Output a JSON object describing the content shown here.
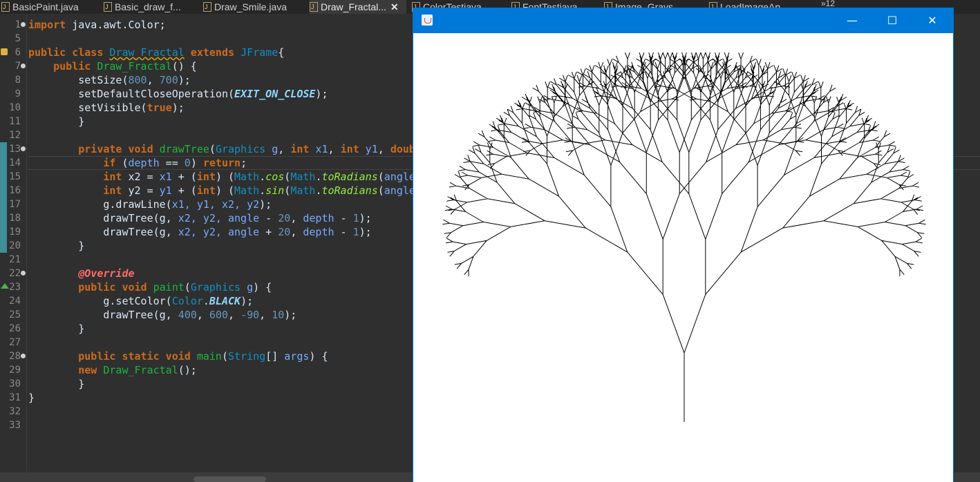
{
  "tabs": [
    {
      "label": "BasicPaint.java",
      "active": false
    },
    {
      "label": "Basic_draw_f...",
      "active": false
    },
    {
      "label": "Draw_Smile.java",
      "active": false
    },
    {
      "label": "Draw_Fractal...",
      "active": true,
      "close": "✕"
    },
    {
      "label": "ColorTestjava",
      "active": false
    },
    {
      "label": "FontTestjava",
      "active": false
    },
    {
      "label": "Image_Grays",
      "active": false
    },
    {
      "label": "LoadImageAp",
      "active": false
    }
  ],
  "tabs_more": "»12",
  "line_numbers": [
    "1",
    "5",
    "6",
    "7",
    "8",
    "9",
    "10",
    "11",
    "12",
    "13",
    "14",
    "15",
    "16",
    "17",
    "18",
    "19",
    "20",
    "21",
    "22",
    "23",
    "24",
    "25",
    "26",
    "27",
    "28",
    "29",
    "30",
    "31",
    "32",
    "33"
  ],
  "code": {
    "l1_import": "import",
    "l1_rest": " java.awt.Color;",
    "l6_a": "public class ",
    "l6_name": "Draw_Fractal",
    "l6_b": " extends ",
    "l6_type": "JFrame",
    "l6_c": "{",
    "l7_a": "    public ",
    "l7_name": "Draw_Fractal",
    "l7_b": "() {",
    "l8_a": "        setSize(",
    "l8_n1": "800",
    "l8_b": ", ",
    "l8_n2": "700",
    "l8_c": ");",
    "l9_a": "        setDefaultCloseOperation(",
    "l9_const": "EXIT_ON_CLOSE",
    "l9_b": ");",
    "l10_a": "        setVisible(",
    "l10_kw": "true",
    "l10_b": ");",
    "l11": "        }",
    "l13_kw": "        private void ",
    "l13_m": "drawTree",
    "l13_a": "(",
    "l13_t": "Graphics",
    "l13_p1": " g",
    "l13_b": ", ",
    "l13_kw2": "int",
    "l13_p2": " x1",
    "l13_c": ", ",
    "l13_kw3": "int",
    "l13_p3": " y1",
    "l13_d": ", ",
    "l13_kw4": "doub",
    "l14_kw": "            if",
    "l14_a": " (",
    "l14_p": "depth",
    "l14_b": " == ",
    "l14_n": "0",
    "l14_c": ") ",
    "l14_kw2": "return",
    "l14_d": ";",
    "l15_kw": "            int",
    "l15_v": " x2",
    "l15_a": " = ",
    "l15_p": "x1",
    "l15_b": " + (",
    "l15_kw2": "int",
    "l15_c": ") (",
    "l15_t": "Math",
    "l15_d": ".",
    "l15_m": "cos",
    "l15_e": "(",
    "l15_t2": "Math",
    "l15_f": ".",
    "l15_m2": "toRadians",
    "l15_g": "(",
    "l15_p2": "angle",
    "l16_kw": "            int",
    "l16_v": " y2",
    "l16_a": " = ",
    "l16_p": "y1",
    "l16_b": " + (",
    "l16_kw2": "int",
    "l16_c": ") (",
    "l16_t": "Math",
    "l16_d": ".",
    "l16_m": "sin",
    "l16_e": "(",
    "l16_t2": "Math",
    "l16_f": ".",
    "l16_m2": "toRadians",
    "l16_g": "(",
    "l16_p2": "angle",
    "l17_a": "            g.drawLine(",
    "l17_p": "x1, y1, x2, y2",
    "l17_b": ");",
    "l18_a": "            drawTree(g, ",
    "l18_p": "x2, y2, angle",
    "l18_b": " - ",
    "l18_n": "20",
    "l18_c": ", ",
    "l18_p2": "depth",
    "l18_d": " - ",
    "l18_n2": "1",
    "l18_e": ");",
    "l19_a": "            drawTree(g, ",
    "l19_p": "x2, y2, angle",
    "l19_b": " + ",
    "l19_n": "20",
    "l19_c": ", ",
    "l19_p2": "depth",
    "l19_d": " - ",
    "l19_n2": "1",
    "l19_e": ");",
    "l20": "        }",
    "l22_an": "        @Override",
    "l23_kw": "        public void ",
    "l23_m": "paint",
    "l23_a": "(",
    "l23_t": "Graphics",
    "l23_p": " g",
    "l23_b": ") {",
    "l24_a": "            g.setColor(",
    "l24_t": "Color",
    "l24_b": ".",
    "l24_c": "BLACK",
    "l24_d": ");",
    "l25_a": "            drawTree(g, ",
    "l25_n1": "400",
    "l25_b": ", ",
    "l25_n2": "600",
    "l25_c": ", ",
    "l25_n3": "-90",
    "l25_d": ", ",
    "l25_n4": "10",
    "l25_e": ");",
    "l26": "        }",
    "l28_kw": "        public static void ",
    "l28_m": "main",
    "l28_a": "(",
    "l28_t": "String",
    "l28_b": "[] ",
    "l28_p": "args",
    "l28_c": ") {",
    "l29_kw": "        new ",
    "l29_m": "Draw_Fractal",
    "l29_a": "();",
    "l30": "        }",
    "l31": "}"
  },
  "window": {
    "minimize": "—",
    "maximize": "☐",
    "close": "✕"
  },
  "tree": {
    "start_angle": -90,
    "depth": 10,
    "spread": 20,
    "length_factor": 10,
    "stroke": "#000000"
  },
  "colors": {
    "accent": "#0078d7",
    "editor_bg": "#2f2f2f",
    "keyword": "#cc6c1d",
    "type": "#1290c3",
    "method": "#1eb540"
  }
}
